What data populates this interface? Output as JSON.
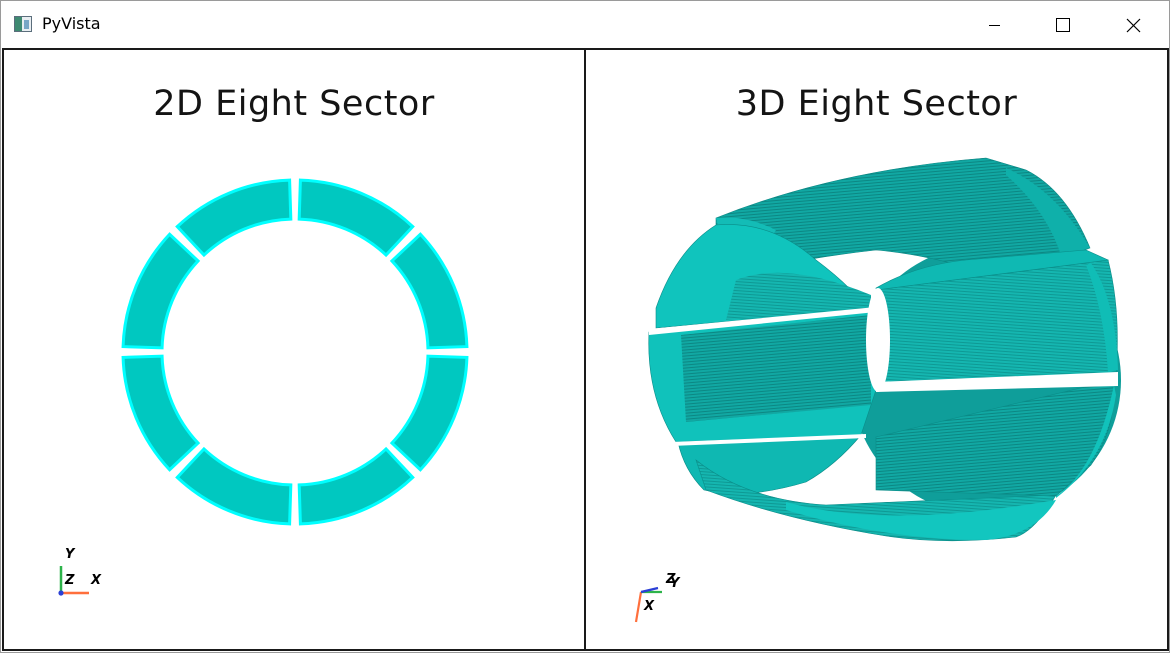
{
  "window": {
    "title": "PyVista"
  },
  "controls": {
    "minimize": "minimize",
    "maximize": "maximize",
    "close": "close"
  },
  "viewports": [
    {
      "title": "2D Eight Sector",
      "axes": {
        "x": "X",
        "y": "Y",
        "z": "Z"
      }
    },
    {
      "title": "3D Eight Sector",
      "axes": {
        "x": "X",
        "y": "Y",
        "z": "Z"
      }
    }
  ],
  "colors": {
    "mesh_fill": "#00c8c0",
    "mesh_edge": "#00ffff",
    "mesh_dark": "#0b8d8a",
    "axis_x": "#ff6f3c",
    "axis_y": "#2db34a",
    "axis_z": "#2b3fd6"
  }
}
